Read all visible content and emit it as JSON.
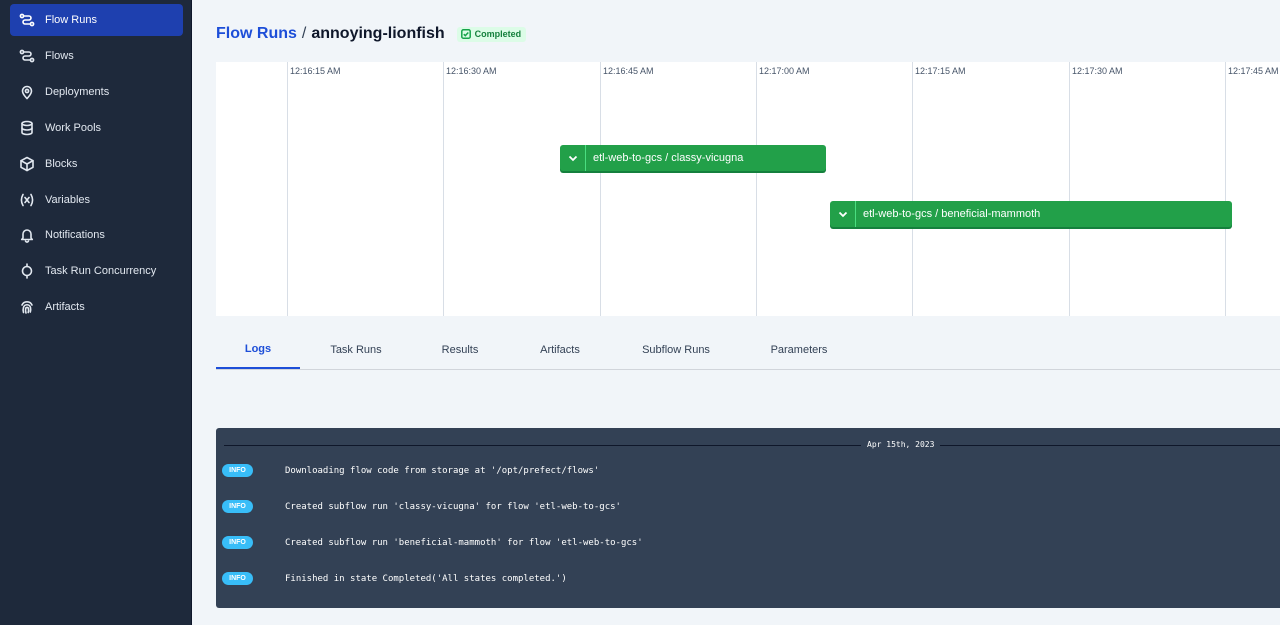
{
  "sidebar": {
    "items": [
      {
        "label": "Flow Runs",
        "icon": "flow-runs-icon",
        "active": true
      },
      {
        "label": "Flows",
        "icon": "flows-icon",
        "active": false
      },
      {
        "label": "Deployments",
        "icon": "map-pin-icon",
        "active": false
      },
      {
        "label": "Work Pools",
        "icon": "database-icon",
        "active": false
      },
      {
        "label": "Blocks",
        "icon": "cube-icon",
        "active": false
      },
      {
        "label": "Variables",
        "icon": "variable-icon",
        "active": false
      },
      {
        "label": "Notifications",
        "icon": "bell-icon",
        "active": false
      },
      {
        "label": "Task Run Concurrency",
        "icon": "concurrency-icon",
        "active": false
      },
      {
        "label": "Artifacts",
        "icon": "fingerprint-icon",
        "active": false
      }
    ]
  },
  "header": {
    "breadcrumb_link": "Flow Runs",
    "separator": "/",
    "run_name": "annoying-lionfish",
    "status": "Completed"
  },
  "timeline": {
    "ticks": [
      "12:16:15 AM",
      "12:16:30 AM",
      "12:16:45 AM",
      "12:17:00 AM",
      "12:17:15 AM",
      "12:17:30 AM",
      "12:17:45 AM"
    ],
    "subflows": [
      {
        "label": "etl-web-to-gcs / classy-vicugna",
        "start": "12:16:41 AM",
        "end": "12:17:06 AM",
        "state": "Completed"
      },
      {
        "label": "etl-web-to-gcs / beneficial-mammoth",
        "start": "12:17:07 AM",
        "end": "12:17:46 AM",
        "state": "Completed"
      }
    ],
    "colors": {
      "completed": "#22a049"
    }
  },
  "tabs": [
    "Logs",
    "Task Runs",
    "Results",
    "Artifacts",
    "Subflow Runs",
    "Parameters"
  ],
  "active_tab": "Logs",
  "logs": {
    "date": "Apr 15th, 2023",
    "entries": [
      {
        "level": "INFO",
        "message": "Downloading flow code from storage at '/opt/prefect/flows'"
      },
      {
        "level": "INFO",
        "message": "Created subflow run 'classy-vicugna' for flow 'etl-web-to-gcs'"
      },
      {
        "level": "INFO",
        "message": "Created subflow run 'beneficial-mammoth' for flow 'etl-web-to-gcs'"
      },
      {
        "level": "INFO",
        "message": "Finished in state Completed('All states completed.')"
      }
    ]
  }
}
